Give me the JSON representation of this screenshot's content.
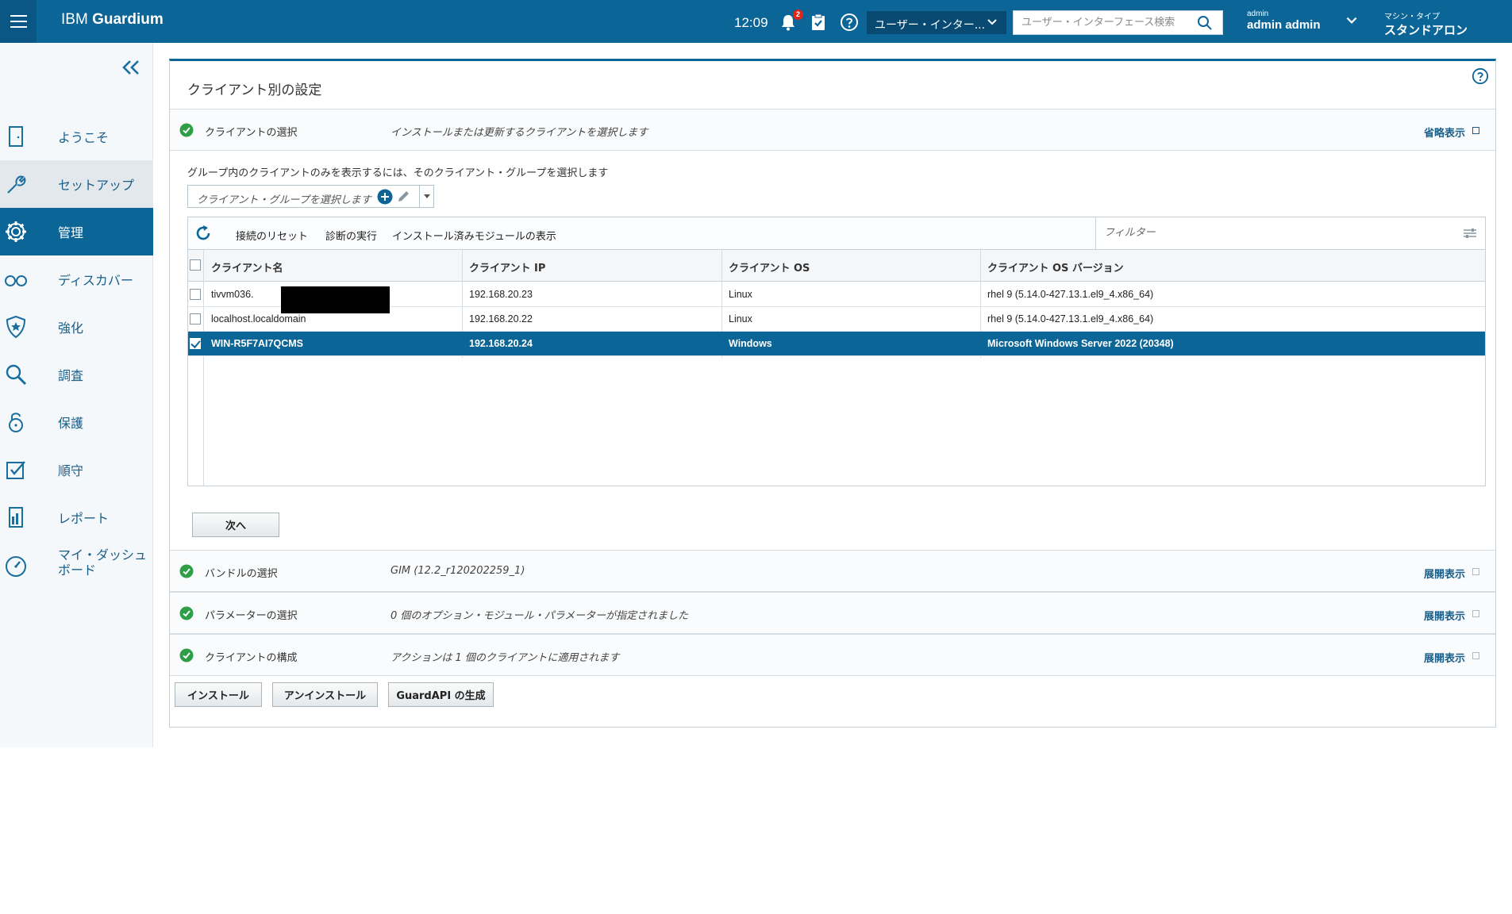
{
  "topbar": {
    "brand_prefix": "IBM",
    "brand_name": "Guardium",
    "clock": "12:09",
    "notification_count": "2",
    "ui_dropdown_label": "ユーザー・インター...",
    "search_placeholder": "ユーザー・インターフェース検索",
    "user_small": "admin",
    "user_big": "admin admin",
    "machine_small": "マシン・タイプ",
    "machine_big": "スタンドアロン"
  },
  "sidebar": {
    "items": [
      {
        "label": "ようこそ",
        "icon": "door-icon"
      },
      {
        "label": "セットアップ",
        "icon": "wrench-icon"
      },
      {
        "label": "管理",
        "icon": "gear-icon"
      },
      {
        "label": "ディスカバー",
        "icon": "glasses-icon"
      },
      {
        "label": "強化",
        "icon": "shield-star-icon"
      },
      {
        "label": "調査",
        "icon": "magnifier-icon"
      },
      {
        "label": "保護",
        "icon": "lock-icon"
      },
      {
        "label": "順守",
        "icon": "checkbox-icon"
      },
      {
        "label": "レポート",
        "icon": "report-icon"
      },
      {
        "label": "マイ・ダッシュ",
        "label2": "ボード",
        "icon": "dashboard-icon"
      }
    ],
    "active_index": 2
  },
  "panel": {
    "title": "クライアント別の設定",
    "steps": [
      {
        "name": "クライアントの選択",
        "desc": "インストールまたは更新するクライアントを選択します",
        "toggle": "省略表示"
      },
      {
        "name": "バンドルの選択",
        "desc": "GIM (12.2_r120202259_1)",
        "toggle": "展開表示"
      },
      {
        "name": "パラメーターの選択",
        "desc": "0 個のオプション・モジュール・パラメーターが指定されました",
        "toggle": "展開表示"
      },
      {
        "name": "クライアントの構成",
        "desc": "アクションは 1 個のクライアントに適用されます",
        "toggle": "展開表示"
      }
    ],
    "group_hint": "グループ内のクライアントのみを表示するには、そのクライアント・グループを選択します",
    "group_placeholder": "クライアント・グループを選択します",
    "toolbar": {
      "reset": "接続のリセット",
      "diagnose": "診断の実行",
      "show_modules": "インストール済みモジュールの表示",
      "filter_placeholder": "フィルター"
    },
    "columns": [
      "クライアント名",
      "クライアント IP",
      "クライアント OS",
      "クライアント OS バージョン"
    ],
    "rows": [
      {
        "name": "tivvm036.",
        "ip": "192.168.20.23",
        "os": "Linux",
        "version": "rhel 9 (5.14.0-427.13.1.el9_4.x86_64)",
        "checked": false,
        "selected": false
      },
      {
        "name": "localhost.localdomain",
        "ip": "192.168.20.22",
        "os": "Linux",
        "version": "rhel 9 (5.14.0-427.13.1.el9_4.x86_64)",
        "checked": false,
        "selected": false
      },
      {
        "name": "WIN-R5F7AI7QCMS",
        "ip": "192.168.20.24",
        "os": "Windows",
        "version": "Microsoft Windows Server 2022 (20348)",
        "checked": true,
        "selected": true
      }
    ],
    "next_button": "次へ",
    "buttons": {
      "install": "インストール",
      "uninstall": "アンインストール",
      "guardapi": "GuardAPI の生成"
    }
  },
  "colors": {
    "brand_blue": "#0c6597",
    "success_green": "#2e9e47",
    "badge_red": "#e2231a"
  }
}
